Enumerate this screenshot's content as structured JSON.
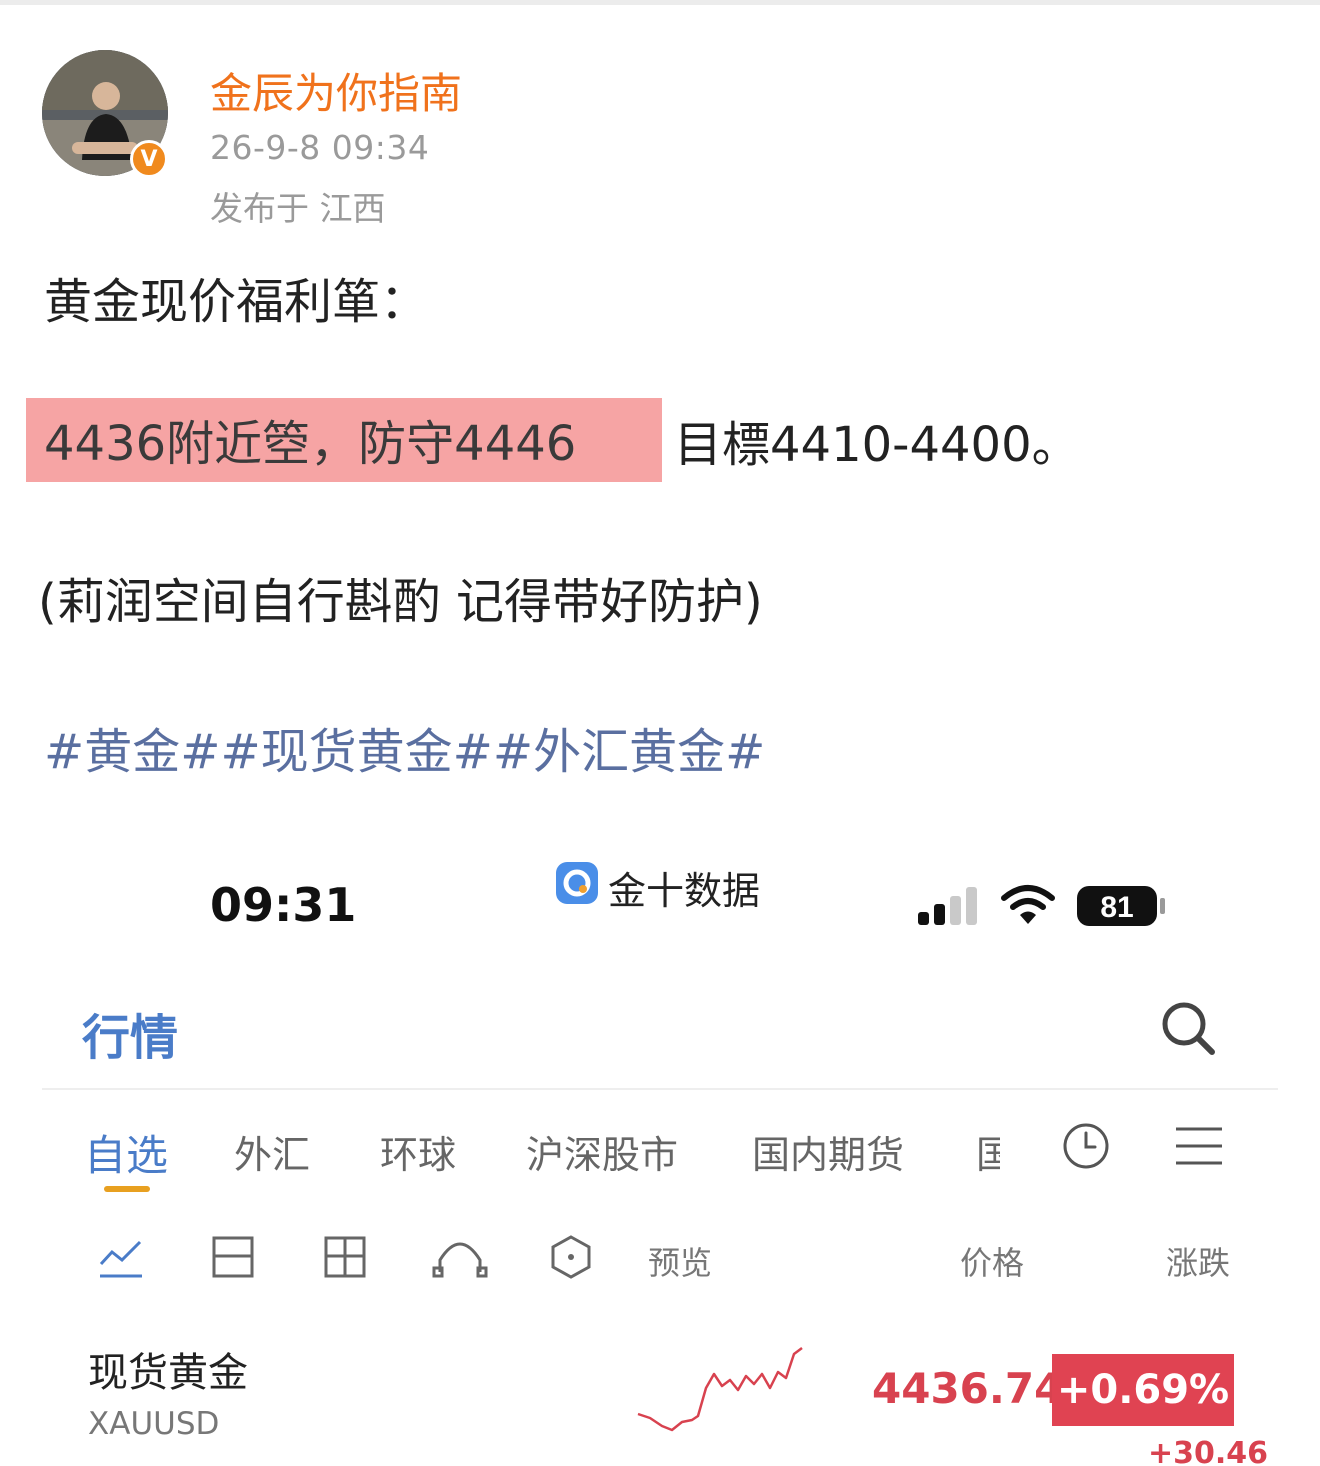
{
  "post": {
    "username": "金辰为你指南",
    "time": "26-9-8 09:34",
    "location": "发布于 江西",
    "verified_mark": "V",
    "line1": "黄金现价福利箪：",
    "highlight": "4436附近箜，防守4446",
    "after_highlight": "目標4410-4400。",
    "line3": "(莉润空间自行斟酌 记得带好防护)",
    "hashtags": "#黄金##现货黄金##外汇黄金#"
  },
  "screenshot": {
    "status_time": "09:31",
    "app_name": "金十数据",
    "battery": "81",
    "page_title": "行情",
    "tabs": [
      {
        "label": "自选",
        "active": true
      },
      {
        "label": "外汇",
        "active": false
      },
      {
        "label": "环球",
        "active": false
      },
      {
        "label": "沪深股市",
        "active": false
      },
      {
        "label": "国内期货",
        "active": false
      },
      {
        "label": "国",
        "active": false
      }
    ],
    "columns": {
      "preview": "预览",
      "price": "价格",
      "change": "涨跌"
    },
    "icons": [
      "line-chart-icon",
      "split-view-icon",
      "grid-icon",
      "arch-icon",
      "hexagon-icon",
      "clock-icon",
      "menu-icon",
      "search-icon"
    ],
    "quote": {
      "name": "现货黄金",
      "code": "XAUUSD",
      "price": "4436.74",
      "change_pct": "+0.69%",
      "change_abs": "+30.46"
    },
    "colors": {
      "accent": "#4a7cc8",
      "up": "#d8424f",
      "username": "#f0721c",
      "hashtag": "#5a6fa0",
      "highlight": "#f6a4a4"
    }
  }
}
